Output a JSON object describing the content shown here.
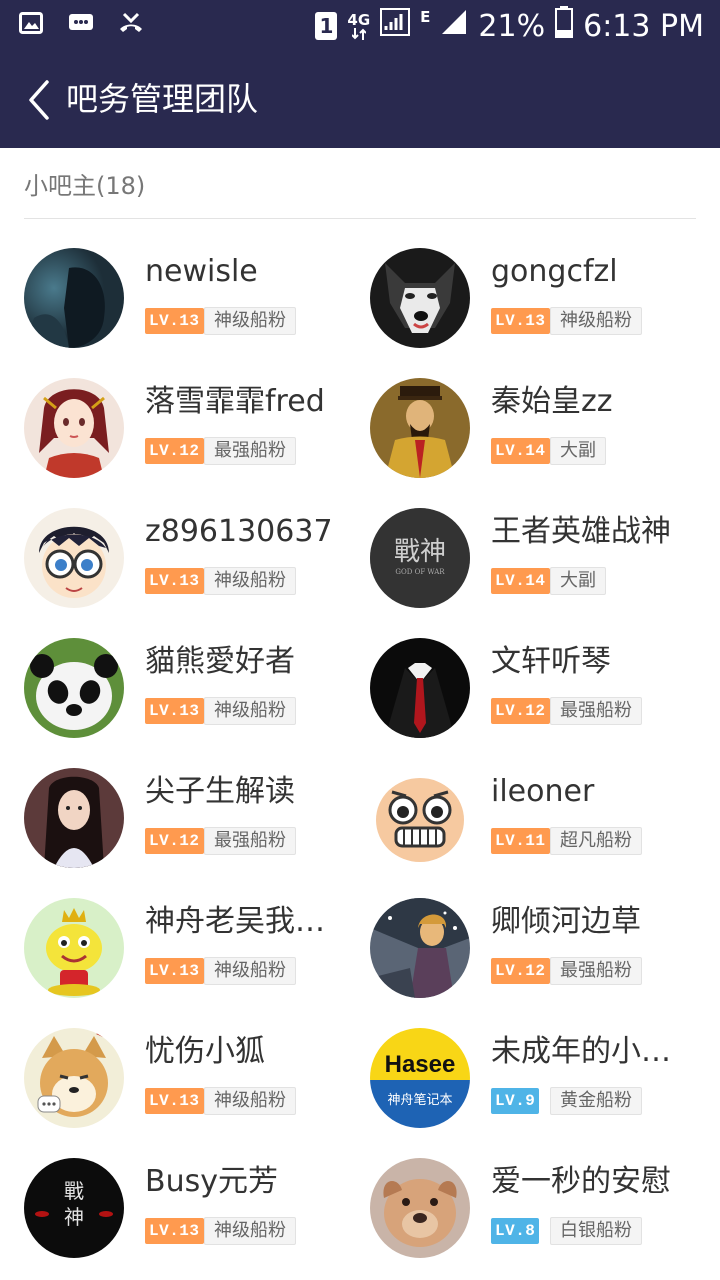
{
  "status_bar": {
    "sim_label": "1",
    "network_4g": "4G",
    "network_e": "E",
    "battery_percent": "21%",
    "time": "6:13 PM",
    "icons": [
      "image-icon",
      "message-icon",
      "missed-call-icon"
    ]
  },
  "header": {
    "title": "吧务管理团队",
    "back_icon": "chevron-left-icon"
  },
  "section": {
    "title": "小吧主(18)"
  },
  "colors": {
    "header_bg": "#29294f",
    "level_orange": "#ff9a4f",
    "level_blue": "#4fb4e7"
  },
  "members": [
    {
      "name": "newisle",
      "level": "LV.13",
      "title": "神级船粉",
      "level_color": "orange",
      "avatar": "avatar-dark-portrait"
    },
    {
      "name": "gongcfzl",
      "level": "LV.13",
      "title": "神级船粉",
      "level_color": "orange",
      "avatar": "avatar-husky"
    },
    {
      "name": "落雪霏霏fred",
      "level": "LV.12",
      "title": "最强船粉",
      "level_color": "orange",
      "avatar": "avatar-anime-girl"
    },
    {
      "name": "秦始皇zz",
      "level": "LV.14",
      "title": "大副",
      "level_color": "orange",
      "avatar": "avatar-emperor-painting"
    },
    {
      "name": "z896130637",
      "level": "LV.13",
      "title": "神级船粉",
      "level_color": "orange",
      "avatar": "avatar-conan"
    },
    {
      "name": "王者英雄战神",
      "level": "LV.14",
      "title": "大副",
      "level_color": "orange",
      "avatar": "avatar-god-of-war"
    },
    {
      "name": "貓熊愛好者",
      "level": "LV.13",
      "title": "神级船粉",
      "level_color": "orange",
      "avatar": "avatar-panda"
    },
    {
      "name": "文轩听琴",
      "level": "LV.12",
      "title": "最强船粉",
      "level_color": "orange",
      "avatar": "avatar-suit-tie"
    },
    {
      "name": "尖子生解读",
      "level": "LV.12",
      "title": "最强船粉",
      "level_color": "orange",
      "avatar": "avatar-woman-portrait"
    },
    {
      "name": "ileoner",
      "level": "LV.11",
      "title": "超凡船粉",
      "level_color": "orange",
      "avatar": "avatar-cartoon-face"
    },
    {
      "name": "神舟老吴我偶…",
      "level": "LV.13",
      "title": "神级船粉",
      "level_color": "orange",
      "avatar": "avatar-yellow-frog"
    },
    {
      "name": "卿倾河边草",
      "level": "LV.12",
      "title": "最强船粉",
      "level_color": "orange",
      "avatar": "avatar-anime-scene"
    },
    {
      "name": "忧伤小狐",
      "level": "LV.13",
      "title": "神级船粉",
      "level_color": "orange",
      "avatar": "avatar-shiba-dog"
    },
    {
      "name": "未成年的小香…",
      "level": "LV.9",
      "title": "黄金船粉",
      "level_color": "blue",
      "avatar": "avatar-hasee-logo",
      "avatar_text_top": "Hasee",
      "avatar_text_bottom": "神舟笔记本"
    },
    {
      "name": "Busy元芳",
      "level": "LV.13",
      "title": "神级船粉",
      "level_color": "orange",
      "avatar": "avatar-war-dark"
    },
    {
      "name": "爱一秒的安慰",
      "level": "LV.8",
      "title": "白银船粉",
      "level_color": "blue",
      "avatar": "avatar-puppy"
    }
  ]
}
